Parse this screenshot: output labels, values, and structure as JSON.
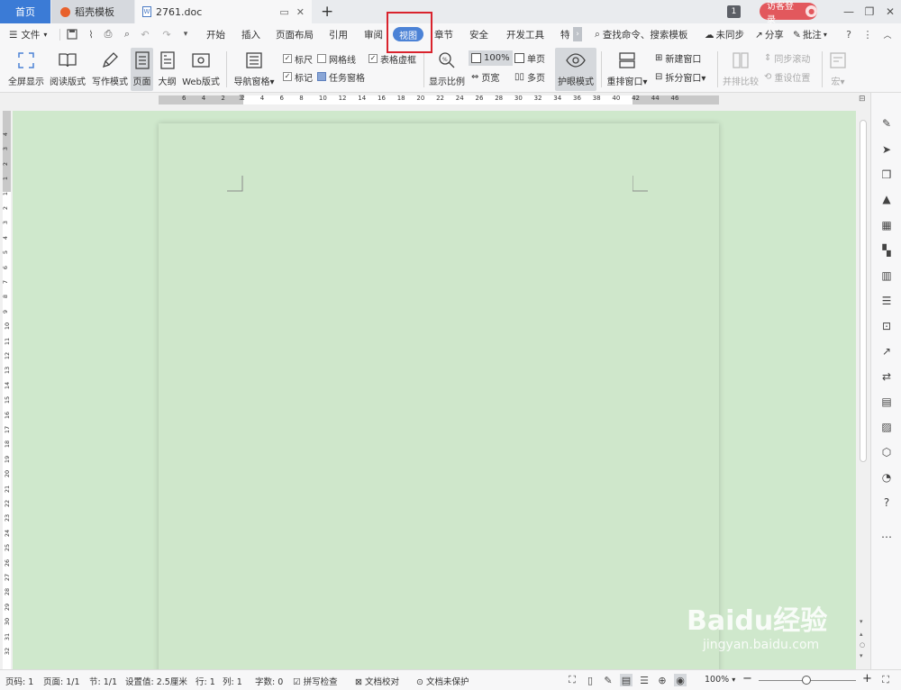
{
  "tabs": {
    "home": "首页",
    "template": "稻壳模板",
    "doc": "2761.doc",
    "badge": "1",
    "login": "访客登录"
  },
  "menubar": {
    "file": "文件",
    "items": [
      "开始",
      "插入",
      "页面布局",
      "引用",
      "审阅",
      "视图",
      "章节",
      "安全",
      "开发工具",
      "特"
    ],
    "search": "查找命令、搜索模板",
    "sync": "未同步",
    "share": "分享",
    "comment": "批注"
  },
  "ribbon": {
    "fullscreen": "全屏显示",
    "reading": "阅读版式",
    "writing": "写作模式",
    "page": "页面",
    "outline": "大纲",
    "web": "Web版式",
    "nav": "导航窗格",
    "ruler": "标尺",
    "gridlines": "网格线",
    "table_grid": "表格虚框",
    "marks": "标记",
    "task_pane": "任务窗格",
    "zoom": "显示比例",
    "zoom100": "100%",
    "page_width": "页宽",
    "single": "单页",
    "multi": "多页",
    "eye": "护眼模式",
    "rearrange": "重排窗口",
    "new_window": "新建窗口",
    "split": "拆分窗口",
    "side_by_side": "并排比较",
    "sync_scroll": "同步滚动",
    "reset_pos": "重设位置",
    "macro": "宏"
  },
  "ruler": {
    "h_numbers": [
      "6",
      "4",
      "2",
      "2",
      "4",
      "6",
      "8",
      "10",
      "12",
      "14",
      "16",
      "18",
      "20",
      "22",
      "24",
      "26",
      "28",
      "30",
      "32",
      "34",
      "36",
      "38",
      "40",
      "42",
      "44",
      "46"
    ],
    "v_numbers": [
      "4",
      "3",
      "2",
      "1",
      "1",
      "2",
      "3",
      "4",
      "5",
      "6",
      "7",
      "8",
      "9",
      "10",
      "11",
      "12",
      "13",
      "14",
      "15",
      "16",
      "17",
      "18",
      "19",
      "20",
      "21",
      "22",
      "23",
      "24",
      "25",
      "26",
      "27",
      "28",
      "29",
      "30",
      "31",
      "32"
    ]
  },
  "status": {
    "page_no": "页码: 1",
    "pages": "页面: 1/1",
    "section": "节: 1/1",
    "setting": "设置值: 2.5厘米",
    "row": "行: 1",
    "col": "列: 1",
    "words": "字数: 0",
    "spell": "拼写检查",
    "proof": "文档校对",
    "protect": "文档未保护",
    "zoom": "100%"
  },
  "watermark": {
    "brand": "Baidu经验",
    "url": "jingyan.baidu.com"
  },
  "colors": {
    "accent": "#4b82d6",
    "highlight": "#d9232d",
    "eye_bg": "#cfe8cc",
    "login": "#e2585d"
  }
}
